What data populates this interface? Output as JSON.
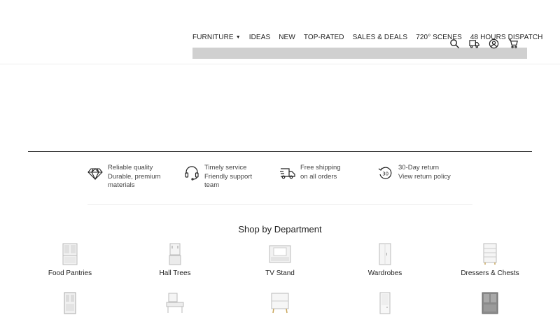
{
  "nav": {
    "items": [
      {
        "label": "FURNITURE",
        "has_dropdown": true
      },
      {
        "label": "IDEAS"
      },
      {
        "label": "NEW"
      },
      {
        "label": "TOP-RATED"
      },
      {
        "label": "SALES & DEALS"
      },
      {
        "label": "720° SCENES"
      },
      {
        "label": "48 HOURS DISPATCH"
      }
    ],
    "icons": [
      "search-icon",
      "delivery-truck-icon",
      "account-icon",
      "cart-icon"
    ]
  },
  "features": [
    {
      "icon": "diamond-icon",
      "line1": "Reliable quality",
      "line2": "Durable, premium",
      "line3": "materials"
    },
    {
      "icon": "headset-icon",
      "line1": "Timely service",
      "line2": "Friendly support",
      "line3": "team"
    },
    {
      "icon": "shipping-truck-icon",
      "line1": "Free shipping",
      "line2": "on all orders",
      "line3": ""
    },
    {
      "icon": "return-30-icon",
      "line1": "30-Day return",
      "line2": "View return policy",
      "line3": ""
    }
  ],
  "departments": {
    "title": "Shop by Department",
    "row1": [
      "Food Pantries",
      "Hall Trees",
      "TV Stand",
      "Wardrobes",
      "Dressers & Chests"
    ]
  },
  "colors": {
    "text": "#222222",
    "divider": "#333333",
    "nav_bar": "#d0d0d0"
  }
}
